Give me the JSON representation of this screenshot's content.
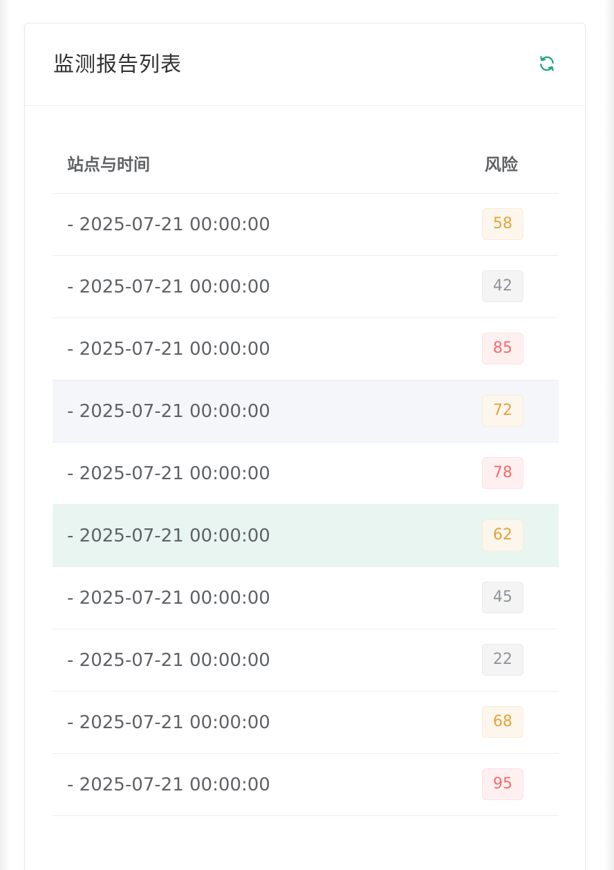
{
  "card": {
    "title": "监测报告列表",
    "refresh_icon": "refresh-icon",
    "accent_color": "#1aa382"
  },
  "table": {
    "headers": {
      "site_time": "站点与时间",
      "risk": "风险"
    },
    "rows": [
      {
        "time": "- 2025-07-21 00:00:00",
        "risk": "58",
        "level": "warning"
      },
      {
        "time": "- 2025-07-21 00:00:00",
        "risk": "42",
        "level": "info"
      },
      {
        "time": "- 2025-07-21 00:00:00",
        "risk": "85",
        "level": "danger"
      },
      {
        "time": "- 2025-07-21 00:00:00",
        "risk": "72",
        "level": "warning"
      },
      {
        "time": "- 2025-07-21 00:00:00",
        "risk": "78",
        "level": "danger"
      },
      {
        "time": "- 2025-07-21 00:00:00",
        "risk": "62",
        "level": "warning"
      },
      {
        "time": "- 2025-07-21 00:00:00",
        "risk": "45",
        "level": "info"
      },
      {
        "time": "- 2025-07-21 00:00:00",
        "risk": "22",
        "level": "info"
      },
      {
        "time": "- 2025-07-21 00:00:00",
        "risk": "68",
        "level": "warning"
      },
      {
        "time": "- 2025-07-21 00:00:00",
        "risk": "95",
        "level": "danger"
      }
    ]
  },
  "status_colors": {
    "warning": "#e6a23c",
    "info": "#909399",
    "danger": "#f56c6c",
    "hover_row": "#f5f6fa",
    "current_row": "#e8f5f1"
  }
}
